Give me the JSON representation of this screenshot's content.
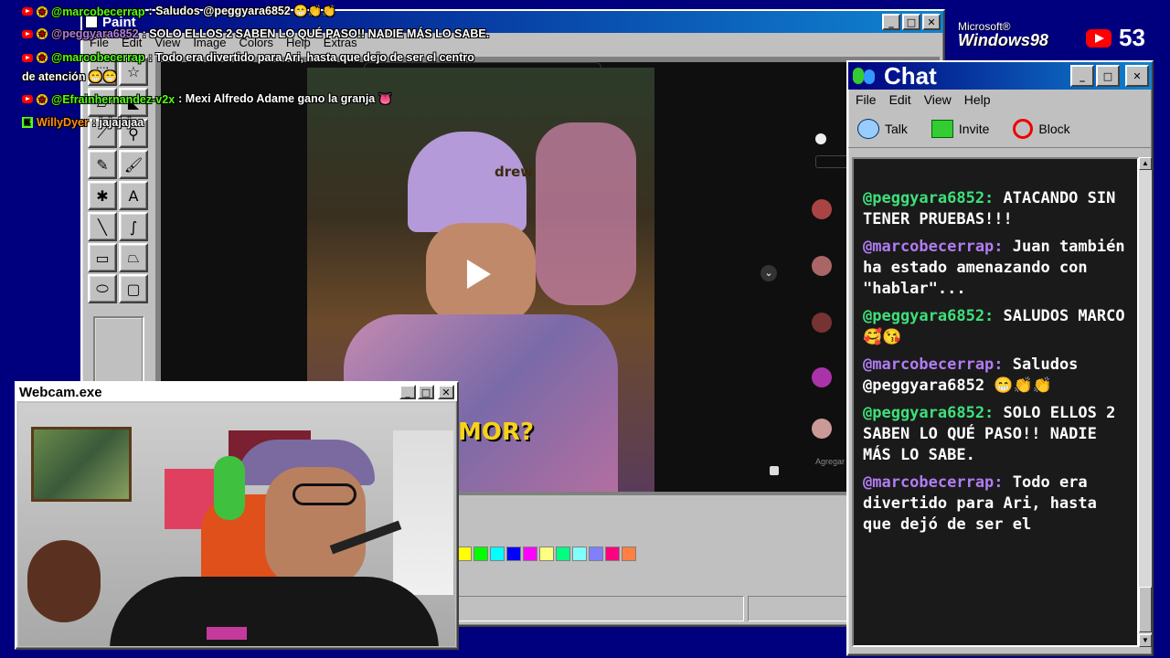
{
  "overlay_chat": [
    {
      "user": "@marcobecerrap",
      "text": " : Saludos @peggyara6852 😁👏👏",
      "color": "#53fc18",
      "platform": "youtube"
    },
    {
      "user": "@peggyara6852",
      "text": " : SOLO ELLOS 2 SABEN LO QUÉ PASO!! NADIE MÁS LO SABE.",
      "color": "#b07cf2",
      "platform": "youtube"
    },
    {
      "user": "@marcobecerrap",
      "text": " : Todo era divertido para Ari, hasta que dejo de ser el centro",
      "color": "#53fc18",
      "platform": "youtube"
    },
    {
      "user": "",
      "text": "de atención 😁😁",
      "color": "#ffffff",
      "platform": "none"
    },
    {
      "user": "@Efrainhernandez-v2x",
      "text": " : Mexi Alfredo Adame gano la granja 👅",
      "color": "#53fc18",
      "platform": "youtube"
    },
    {
      "user": "WillyDyer",
      "text": " : jajajajaa",
      "color": "#ff8c1a",
      "platform": "kick"
    }
  ],
  "windows_logo": {
    "line1": "Microsoft®",
    "line2": "Windows98"
  },
  "viewer_count": "53",
  "paint": {
    "title": "Paint",
    "menu": [
      "File",
      "Edit",
      "View",
      "Image",
      "Colors",
      "Help",
      "Extras"
    ],
    "palette": [
      "#ffff00",
      "#00ff00",
      "#00ffff",
      "#0000ff",
      "#ff00ff",
      "#ffff80",
      "#00ff80",
      "#80ffff",
      "#8080ff",
      "#ff0080",
      "#ff8040"
    ]
  },
  "video": {
    "caption": "MOR?",
    "hat_text": "drew",
    "comment_placeholder": "Agregar"
  },
  "webcam": {
    "title": "Webcam.exe"
  },
  "chat": {
    "title": "Chat",
    "menu": [
      "File",
      "Edit",
      "View",
      "Help"
    ],
    "toolbar": {
      "talk": "Talk",
      "invite": "Invite",
      "block": "Block"
    },
    "messages": [
      {
        "user": "@peggyara6852:",
        "text": " ATACANDO SIN TENER PRUEBAS!!!",
        "cls": "u-green"
      },
      {
        "user": "@marcobecerrap:",
        "text": " Juan también ha estado amenazando con \"hablar\"...",
        "cls": "u-purple"
      },
      {
        "user": "@peggyara6852:",
        "text": " SALUDOS MARCO 🥰😘",
        "cls": "u-green"
      },
      {
        "user": "@marcobecerrap:",
        "text": " Saludos @peggyara6852 😁👏👏",
        "cls": "u-purple"
      },
      {
        "user": "@peggyara6852:",
        "text": " SOLO ELLOS 2 SABEN LO QUÉ PASO!! NADIE MÁS LO SABE.",
        "cls": "u-green"
      },
      {
        "user": "@marcobecerrap:",
        "text": " Todo era divertido para Ari, hasta que dejó de ser el",
        "cls": "u-purple"
      }
    ]
  }
}
